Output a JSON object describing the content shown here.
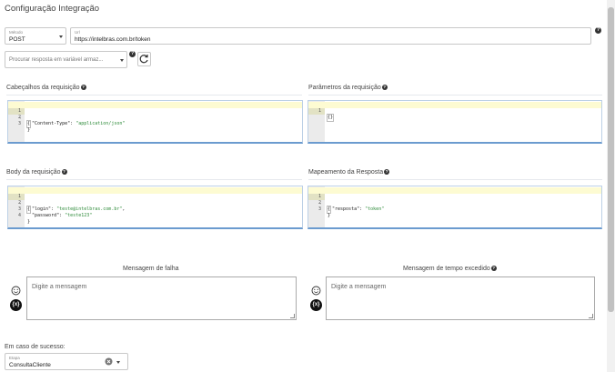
{
  "page": {
    "title": "Configuração Integração"
  },
  "method": {
    "label": "Método",
    "value": "POST"
  },
  "url": {
    "label": "Url",
    "value": "https://intelbras.com.br/token"
  },
  "response_var": {
    "placeholder": "Procurar resposta em variável armaz..."
  },
  "sections": {
    "headers": "Cabeçalhos da requisição",
    "params": "Parâmetros da requisição",
    "body": "Body da requisição",
    "mapping": "Mapeamento da Resposta",
    "failure_msg": "Mensagem de falha",
    "timeout_msg": "Mensagem de tempo excedido"
  },
  "editors": {
    "headers": {
      "line_numbers": [
        "1",
        "2",
        "3"
      ],
      "l1": "{",
      "l2_key": "\"Content-Type\"",
      "l2_sep": ": ",
      "l2_val": "\"application/json\"",
      "l3": "}"
    },
    "params": {
      "line_numbers": [
        "1"
      ],
      "l1": "{}"
    },
    "body": {
      "line_numbers": [
        "1",
        "2",
        "3",
        "4"
      ],
      "l1": "{",
      "l2_key": "\"login\"",
      "l2_sep": ": ",
      "l2_val": "\"teste@intelbras.com.br\"",
      "l2_end": ",",
      "l3_key": "\"password\"",
      "l3_sep": ": ",
      "l3_val": "\"teste123\"",
      "l4": "}"
    },
    "mapping": {
      "line_numbers": [
        "1",
        "2",
        "3"
      ],
      "l1": "{",
      "l2_key": "\"resposta\"",
      "l2_sep": ": ",
      "l2_val": "\"token\"",
      "l3": "}"
    }
  },
  "messages": {
    "failure_placeholder": "Digite a mensagem",
    "timeout_placeholder": "Digite a mensagem",
    "var_button": "{x}"
  },
  "success": {
    "label": "Em caso de sucesso:",
    "field_label": "Etapa",
    "value": "ConsultaCliente"
  },
  "icons": {
    "help": "?",
    "refresh": "refresh-icon",
    "emoji": "smiley-icon",
    "clear": "clear-icon",
    "fold": "▾"
  }
}
